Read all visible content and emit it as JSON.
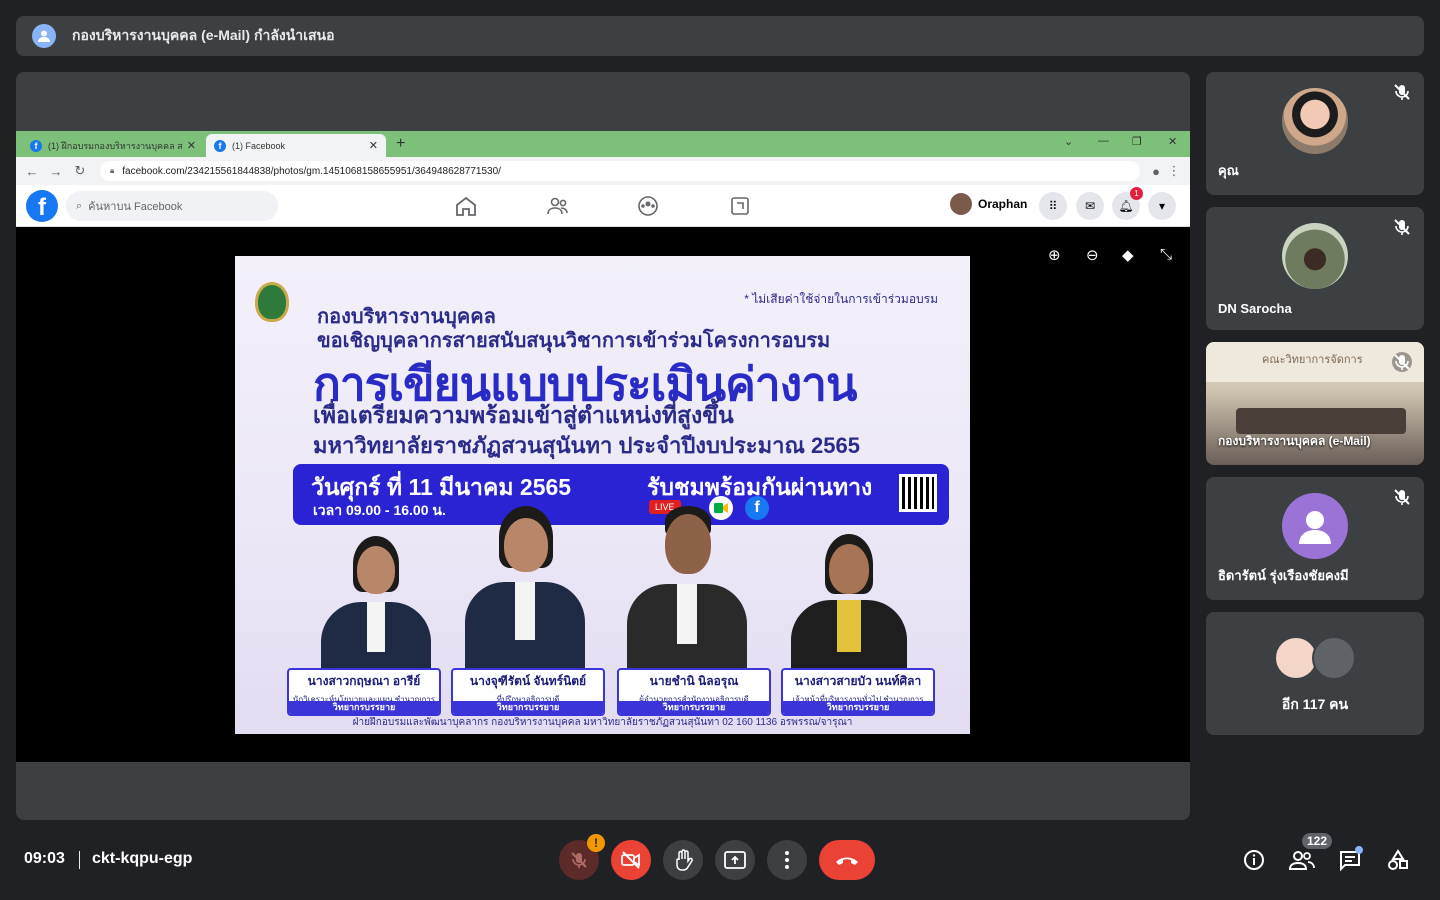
{
  "presenter": {
    "text": "กองบริหารงานบุคคล (e-Mail) กำลังนำเสนอ"
  },
  "browser": {
    "tabs": [
      {
        "label": "(1) ฝึกอบรมกองบริหารงานบุคคล สวนสุ"
      },
      {
        "label": "(1) Facebook"
      }
    ],
    "url": "facebook.com/234215561844838/photos/gm.1451068158655951/364948628771530/"
  },
  "facebook": {
    "search_placeholder": "ค้นหาบน Facebook",
    "user_name": "Oraphan",
    "notification_count": "1"
  },
  "poster": {
    "note": "* ไม่เสียค่าใช้จ่ายในการเข้าร่วมอบรม",
    "line1": "กองบริหารงานบุคคล",
    "line2": "ขอเชิญบุคลากรสายสนับสนุนวิชาการเข้าร่วมโครงการอบรม",
    "headline": "การเขียนแบบประเมินค่างาน",
    "line4": "เพื่อเตรียมความพร้อมเข้าสู่ตำแหน่งที่สูงขึ้น",
    "line5": "มหาวิทยาลัยราชภัฏสวนสุนันทา ประจำปีงบประมาณ 2565",
    "date": "วันศุกร์ ที่ 11 มีนาคม 2565",
    "time": "เวลา 09.00 - 16.00 น.",
    "watch": "รับชมพร้อมกันผ่านทาง",
    "live": "LIVE",
    "speakers": [
      {
        "name": "นางสาวกฤษณา อารีย์",
        "role": "นักวิเคราะห์นโยบายและแผน ชำนาญการ",
        "tag": "วิทยากรบรรยาย"
      },
      {
        "name": "นางจุฑีรัตน์ จันทร์นิตย์",
        "role": "ที่ปรึกษาอธิการบดี",
        "tag": "วิทยากรบรรยาย"
      },
      {
        "name": "นายชำนิ นิลอรุณ",
        "role": "ผู้อำนวยการสำนักงานอธิการบดี",
        "tag": "วิทยากรบรรยาย"
      },
      {
        "name": "นางสาวสายบัว นนท์ศิลา",
        "role": "เจ้าหน้าที่บริหารงานทั่วไป ชำนาญการ",
        "tag": "วิทยากรบรรยาย"
      }
    ],
    "footer": "ฝ่ายฝึกอบรมและพัฒนาบุคลากร กองบริหารงานบุคคล มหาวิทยาลัยราชภัฏสวนสุนันทา 02 160 1136 อรพรรณ/จารุณา"
  },
  "participants": [
    {
      "name": "คุณ"
    },
    {
      "name": "DN Sarocha"
    },
    {
      "name": "กองบริหารงานบุคคล (e-Mail)",
      "wall_text": "คณะวิทยาการจัดการ"
    },
    {
      "name": "ธิดารัตน์ รุ่งเรืองชัยคงมี"
    }
  ],
  "more": {
    "label": "อีก 117 คน"
  },
  "meeting": {
    "time": "09:03",
    "code": "ckt-kqpu-egp",
    "participant_count": "122"
  },
  "colors": {
    "accent_red": "#ea4335",
    "facebook_blue": "#1877f2",
    "warning": "#f29900"
  }
}
